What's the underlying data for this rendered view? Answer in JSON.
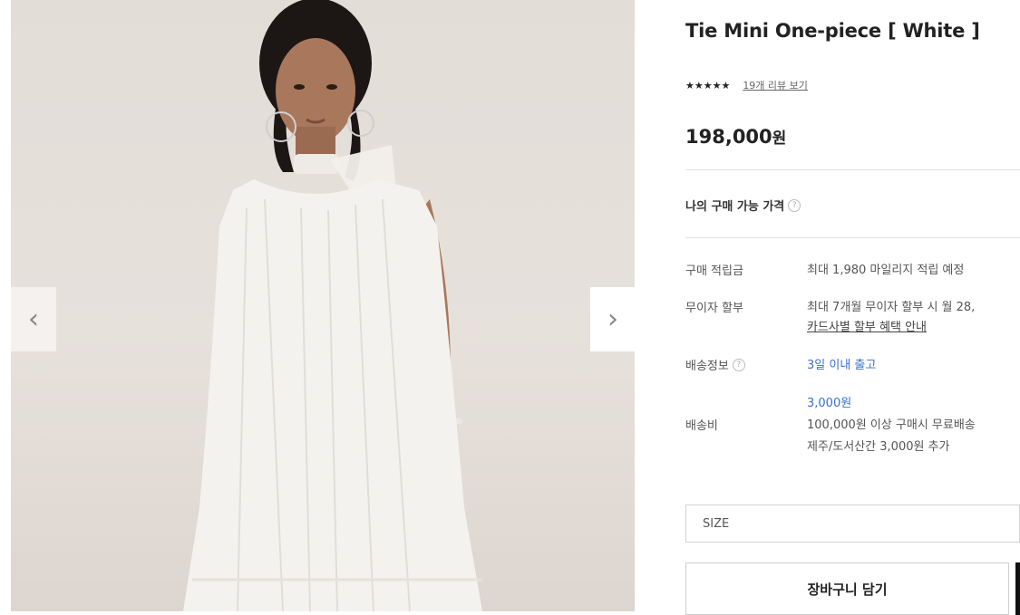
{
  "product": {
    "title": "Tie Mini One-piece [ White ]",
    "stars": "★★★★★",
    "review_link": "19개 리뷰 보기",
    "price_number": "198,000",
    "price_unit": "원"
  },
  "gallery": {
    "prev_arrow": "‹",
    "next_arrow": "›"
  },
  "my_price": {
    "label": "나의 구매 가능 가격",
    "help_icon": "?"
  },
  "details": {
    "points_label": "구매 적립금",
    "points_value": "최대 1,980 마일리지 적립 예정",
    "installment_label": "무이자 할부",
    "installment_value": "최대 7개월 무이자 할부 시 월 28,",
    "installment_link": "카드사별 할부 혜택 안내",
    "shipping_label": "배송정보",
    "shipping_help_icon": "?",
    "shipping_value": "3일 이내 출고",
    "fee_label": "배송비",
    "fee_amount": "3,000원",
    "fee_free": "100,000원 이상 구매시 무료배송",
    "fee_extra": "제주/도서산간 3,000원 추가"
  },
  "options": {
    "size_label": "SIZE"
  },
  "actions": {
    "cart_label": "장바구니 담기"
  }
}
